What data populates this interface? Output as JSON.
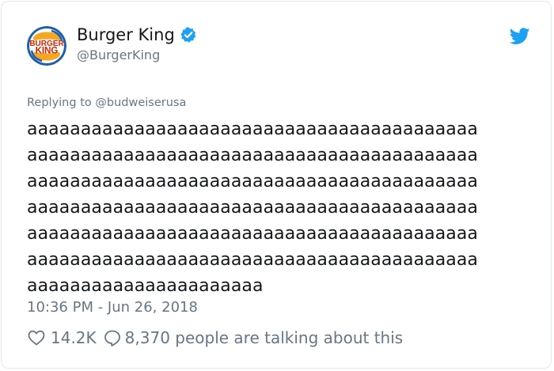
{
  "tweet": {
    "author": {
      "name": "Burger King",
      "handle": "@BurgerKing",
      "logo_text_top": "BURGER",
      "logo_text_bottom": "KING",
      "verified": true
    },
    "reply_prefix": "Replying to ",
    "reply_to": "@budweiserusa",
    "text_lines": [
      "aaaaaaaaaaaaaaaaaaaaaaaaaaaaaaaaaaaaaaaaaa",
      "aaaaaaaaaaaaaaaaaaaaaaaaaaaaaaaaaaaaaaaaaa",
      "aaaaaaaaaaaaaaaaaaaaaaaaaaaaaaaaaaaaaaaaaa",
      "aaaaaaaaaaaaaaaaaaaaaaaaaaaaaaaaaaaaaaaaaa",
      "aaaaaaaaaaaaaaaaaaaaaaaaaaaaaaaaaaaaaaaaaa",
      "aaaaaaaaaaaaaaaaaaaaaaaaaaaaaaaaaaaaaaaaaa",
      "aaaaaaaaaaaaaaaaaaaaaa"
    ],
    "timestamp": "10:36 PM - Jun 26, 2018",
    "likes": "14.2K",
    "talking": "8,370 people are talking about this"
  },
  "colors": {
    "text": "#14171a",
    "secondary": "#657786",
    "link": "#1da1f2",
    "verified": "#1da1f2",
    "border": "#e1e8ed",
    "logo_red": "#d62300",
    "logo_orange": "#f5a623",
    "logo_blue": "#1f5fa8"
  },
  "icons": {
    "verified": "verified-badge-icon",
    "brand": "twitter-bird-icon",
    "like": "heart-outline-icon",
    "reply": "speech-bubble-icon"
  }
}
